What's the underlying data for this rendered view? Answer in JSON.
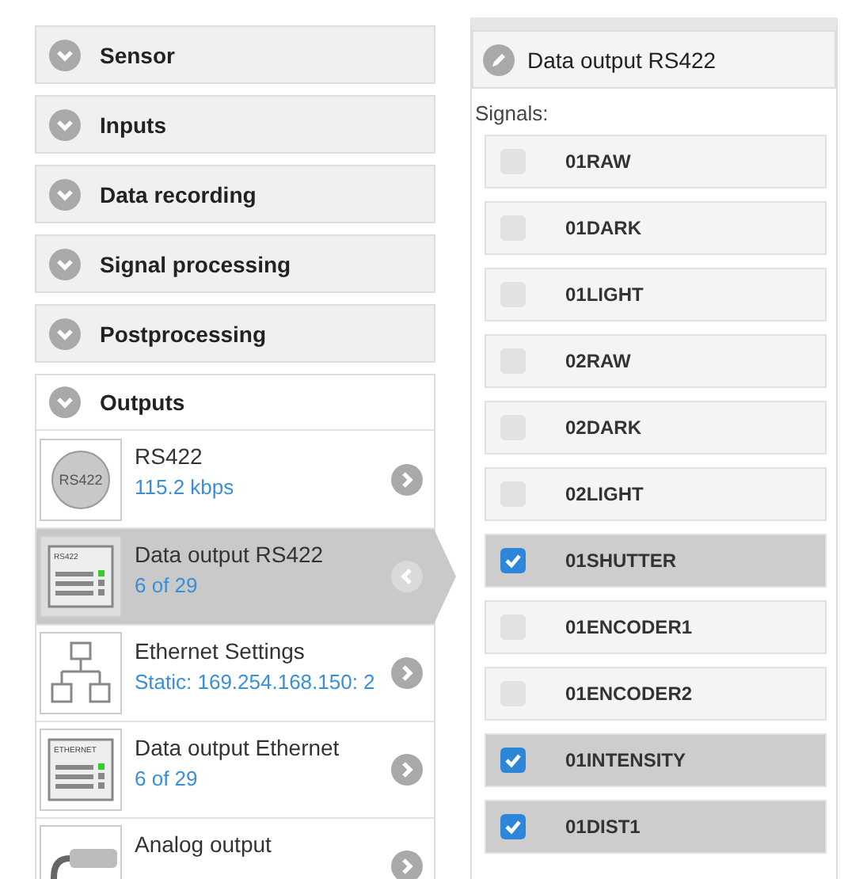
{
  "sections": [
    {
      "label": "Sensor",
      "expanded": false
    },
    {
      "label": "Inputs",
      "expanded": false
    },
    {
      "label": "Data recording",
      "expanded": false
    },
    {
      "label": "Signal processing",
      "expanded": false
    },
    {
      "label": "Postprocessing",
      "expanded": false
    },
    {
      "label": "Outputs",
      "expanded": true,
      "items": [
        {
          "kind": "round",
          "icon_label": "RS422",
          "title": "RS422",
          "subtitle": "115.2 kbps",
          "selected": false
        },
        {
          "kind": "panel",
          "icon_label": "RS422",
          "title": "Data output RS422",
          "subtitle": "6 of 29",
          "selected": true
        },
        {
          "kind": "network",
          "title": "Ethernet Settings",
          "subtitle": "Static: 169.254.168.150: 2",
          "selected": false
        },
        {
          "kind": "panel",
          "icon_label": "ETHERNET",
          "title": "Data output Ethernet",
          "subtitle": "6 of 29",
          "selected": false
        },
        {
          "kind": "cable",
          "title": "Analog output",
          "selected": false
        }
      ]
    }
  ],
  "detail": {
    "title": "Data output RS422",
    "signals_label": "Signals:",
    "signals": [
      {
        "name": "01RAW",
        "checked": false
      },
      {
        "name": "01DARK",
        "checked": false
      },
      {
        "name": "01LIGHT",
        "checked": false
      },
      {
        "name": "02RAW",
        "checked": false
      },
      {
        "name": "02DARK",
        "checked": false
      },
      {
        "name": "02LIGHT",
        "checked": false
      },
      {
        "name": "01SHUTTER",
        "checked": true
      },
      {
        "name": "01ENCODER1",
        "checked": false
      },
      {
        "name": "01ENCODER2",
        "checked": false
      },
      {
        "name": "01INTENSITY",
        "checked": true
      },
      {
        "name": "01DIST1",
        "checked": true
      }
    ]
  }
}
